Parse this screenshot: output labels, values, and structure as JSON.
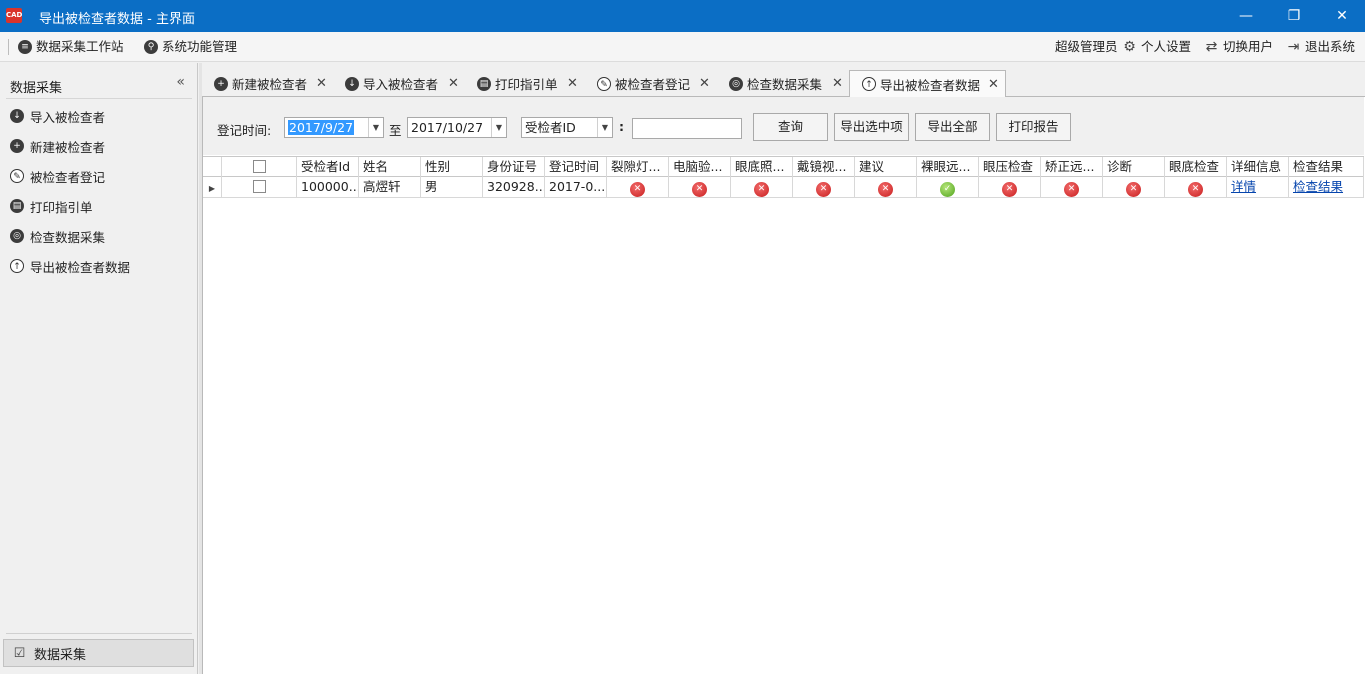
{
  "window": {
    "title": "导出被检查者数据 - 主界面",
    "app_icon": "CAD",
    "minimize": "—",
    "restore": "❐",
    "close": "✕"
  },
  "toolbar": {
    "workstation": "数据采集工作站",
    "system_mgmt": "系统功能管理",
    "user": "超级管理员",
    "settings": "个人设置",
    "switch_user": "切换用户",
    "logout": "退出系统"
  },
  "sidebar": {
    "header": "数据采集",
    "collapse": "«",
    "items": [
      {
        "label": "导入被检查者",
        "icon": "download-icon"
      },
      {
        "label": "新建被检查者",
        "icon": "plus-icon"
      },
      {
        "label": "被检查者登记",
        "icon": "pencil-icon"
      },
      {
        "label": "打印指引单",
        "icon": "printer-icon"
      },
      {
        "label": "检查数据采集",
        "icon": "eye-icon"
      },
      {
        "label": "导出被检查者数据",
        "icon": "upload-icon"
      }
    ],
    "bottom_label": "数据采集"
  },
  "tabs": [
    {
      "label": "新建被检查者",
      "active": false
    },
    {
      "label": "导入被检查者",
      "active": false
    },
    {
      "label": "打印指引单",
      "active": false
    },
    {
      "label": "被检查者登记",
      "active": false
    },
    {
      "label": "检查数据采集",
      "active": false
    },
    {
      "label": "导出被检查者数据",
      "active": true
    }
  ],
  "filter": {
    "date_label": "登记时间:",
    "date_from": "2017/9/27",
    "to_label": "至",
    "date_to": "2017/10/27",
    "field_select": "受检者ID",
    "colon": ":",
    "search_value": "",
    "query_button": "查询",
    "export_selected_button": "导出选中项",
    "export_all_button": "导出全部",
    "print_report_button": "打印报告"
  },
  "grid": {
    "columns": [
      "受检者Id",
      "姓名",
      "性别",
      "身份证号",
      "登记时间",
      "裂隙灯...",
      "电脑验...",
      "眼底照...",
      "戴镜视...",
      "建议",
      "裸眼远...",
      "眼压检查",
      "矫正远...",
      "诊断",
      "眼底检查",
      "详细信息",
      "检查结果"
    ],
    "rows": [
      {
        "id": "100000...",
        "name": "高熤轩",
        "gender": "男",
        "id_card": "320928...",
        "reg_time": "2017-0...",
        "status": [
          "fail",
          "fail",
          "fail",
          "fail",
          "fail",
          "pass",
          "fail",
          "fail",
          "fail",
          "fail"
        ],
        "detail_link": "详情",
        "result_link": "检查结果"
      }
    ]
  },
  "colors": {
    "titlebar": "#0b6ec5",
    "fail": "#d42a2a",
    "pass": "#5db324",
    "selection": "#3399ff",
    "link": "#0645ad"
  }
}
